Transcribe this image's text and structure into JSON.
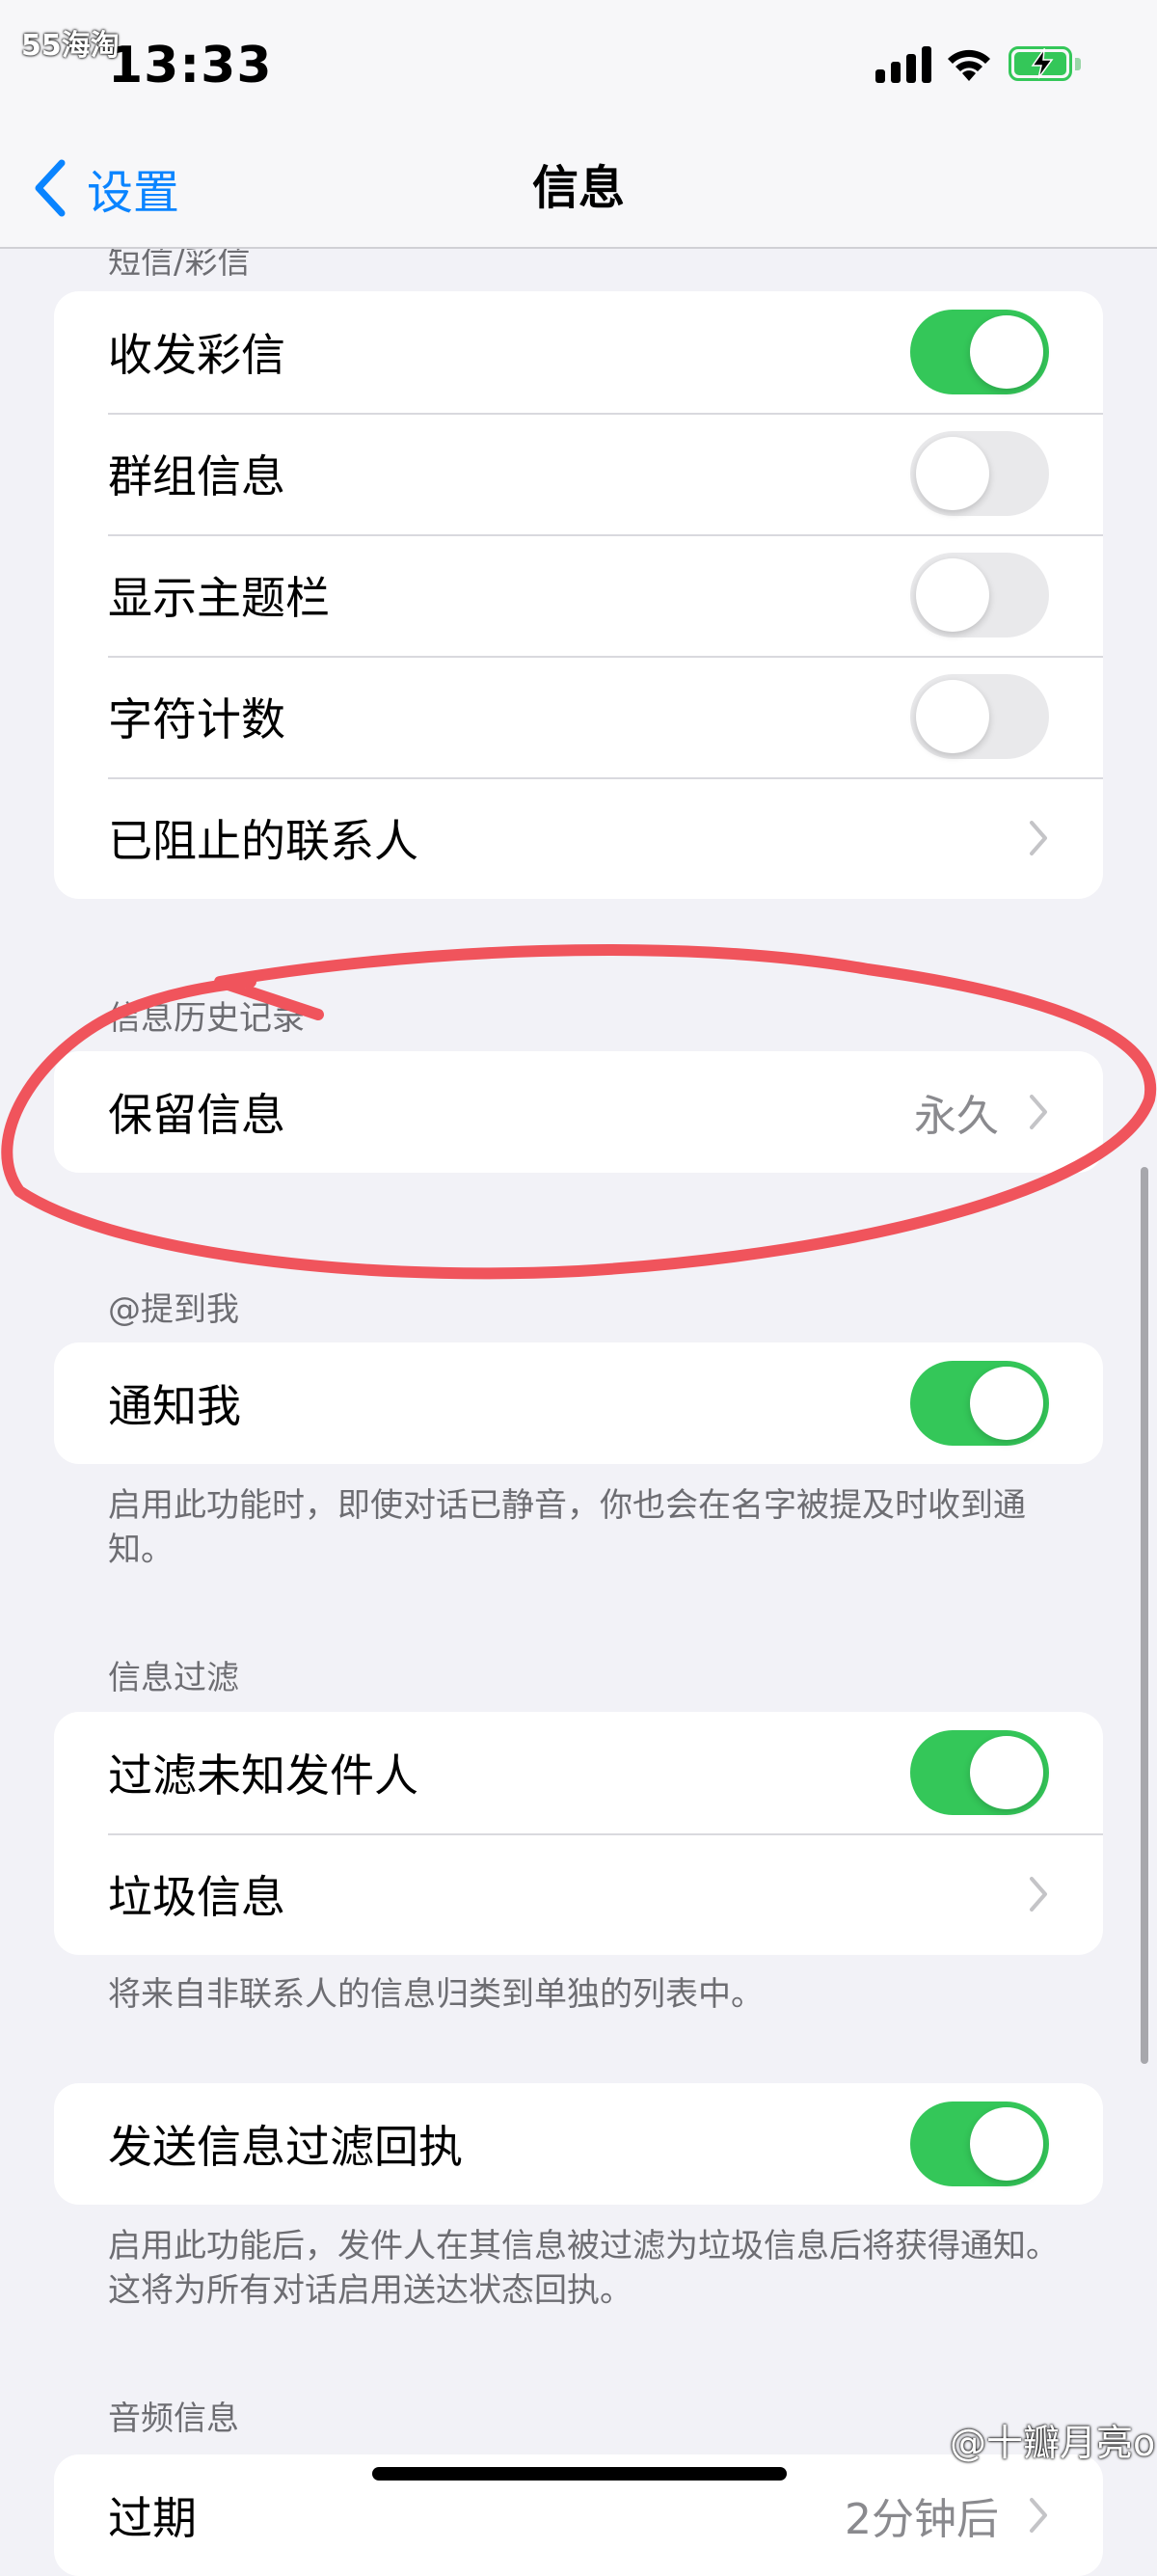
{
  "watermark_top": "55海淘",
  "status": {
    "time": "13:33"
  },
  "nav": {
    "back_label": "设置",
    "title": "信息"
  },
  "sms_mms": {
    "header": "短信/彩信",
    "rows": [
      {
        "label": "收发彩信",
        "toggle": "on"
      },
      {
        "label": "群组信息",
        "toggle": "off"
      },
      {
        "label": "显示主题栏",
        "toggle": "off"
      },
      {
        "label": "字符计数",
        "toggle": "off"
      },
      {
        "label": "已阻止的联系人"
      }
    ]
  },
  "history": {
    "header": "信息历史记录",
    "keep_label": "保留信息",
    "keep_value": "永久"
  },
  "mentions": {
    "header": "@提到我",
    "notify_label": "通知我",
    "notify_toggle": "on",
    "footer": "启用此功能时，即使对话已静音，你也会在名字被提及时收到通知。"
  },
  "filtering": {
    "header": "信息过滤",
    "filter_unknown_label": "过滤未知发件人",
    "filter_unknown_toggle": "on",
    "junk_label": "垃圾信息",
    "footer": "将来自非联系人的信息归类到单独的列表中。"
  },
  "filter_receipts": {
    "label": "发送信息过滤回执",
    "toggle": "on",
    "footer": "启用此功能后，发件人在其信息被过滤为垃圾信息后将获得通知。这将为所有对话启用送达状态回执。"
  },
  "audio": {
    "header": "音频信息",
    "expire_label": "过期",
    "expire_value": "2分钟后"
  },
  "watermark_bottom": "@十瓣月亮o",
  "colors": {
    "accent": "#0a84ff",
    "toggle_on": "#34c759",
    "annotation": "#f0545c"
  },
  "icons": [
    "cellular-signal-icon",
    "wifi-icon",
    "battery-charging-icon",
    "back-chevron-icon",
    "chevron-right-icon"
  ]
}
